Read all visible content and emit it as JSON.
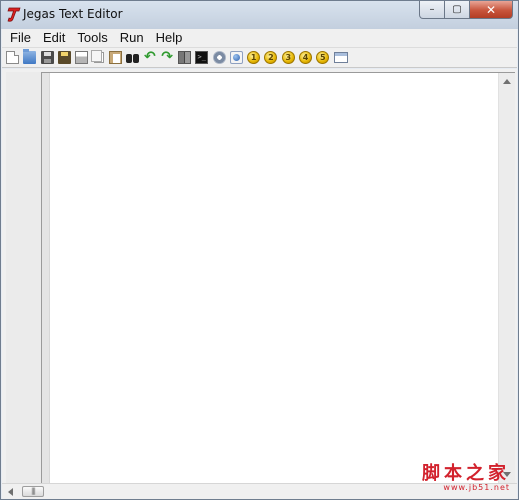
{
  "window": {
    "title": "Jegas Text Editor",
    "background_tab_text": "",
    "close_glyph": "✕",
    "maximize_glyph": "▢",
    "minimize_glyph": "–"
  },
  "colors": {
    "title_gradient_top": "#d8e2ee",
    "close_button": "#c8553c",
    "watermark": "#d2222d"
  },
  "menu": [
    {
      "label": "File"
    },
    {
      "label": "Edit"
    },
    {
      "label": "Tools"
    },
    {
      "label": "Run"
    },
    {
      "label": "Help"
    }
  ],
  "toolbar": {
    "buttons": [
      {
        "icon": "new-file-icon"
      },
      {
        "icon": "open-folder-icon"
      },
      {
        "icon": "save-icon"
      },
      {
        "icon": "save-all-icon"
      },
      {
        "icon": "print-icon"
      },
      {
        "icon": "copy-icon"
      },
      {
        "icon": "paste-icon"
      },
      {
        "icon": "find-binoculars-icon"
      },
      {
        "icon": "undo-icon",
        "glyph": "↶"
      },
      {
        "icon": "redo-icon",
        "glyph": "↷"
      },
      {
        "icon": "book-icon"
      },
      {
        "icon": "terminal-icon",
        "glyph": ">_"
      },
      {
        "icon": "settings-gear-icon"
      },
      {
        "icon": "browser-icon"
      },
      {
        "icon": "macro-1-icon",
        "glyph": "1"
      },
      {
        "icon": "macro-2-icon",
        "glyph": "2"
      },
      {
        "icon": "macro-3-icon",
        "glyph": "3"
      },
      {
        "icon": "macro-4-icon",
        "glyph": "4"
      },
      {
        "icon": "macro-5-icon",
        "glyph": "5"
      },
      {
        "icon": "window-icon"
      }
    ]
  },
  "editor": {
    "content": ""
  },
  "statusbar": {
    "hscroll_grip": "|||"
  },
  "watermark": {
    "chinese": "脚本之家",
    "url": "www.jb51.net"
  }
}
